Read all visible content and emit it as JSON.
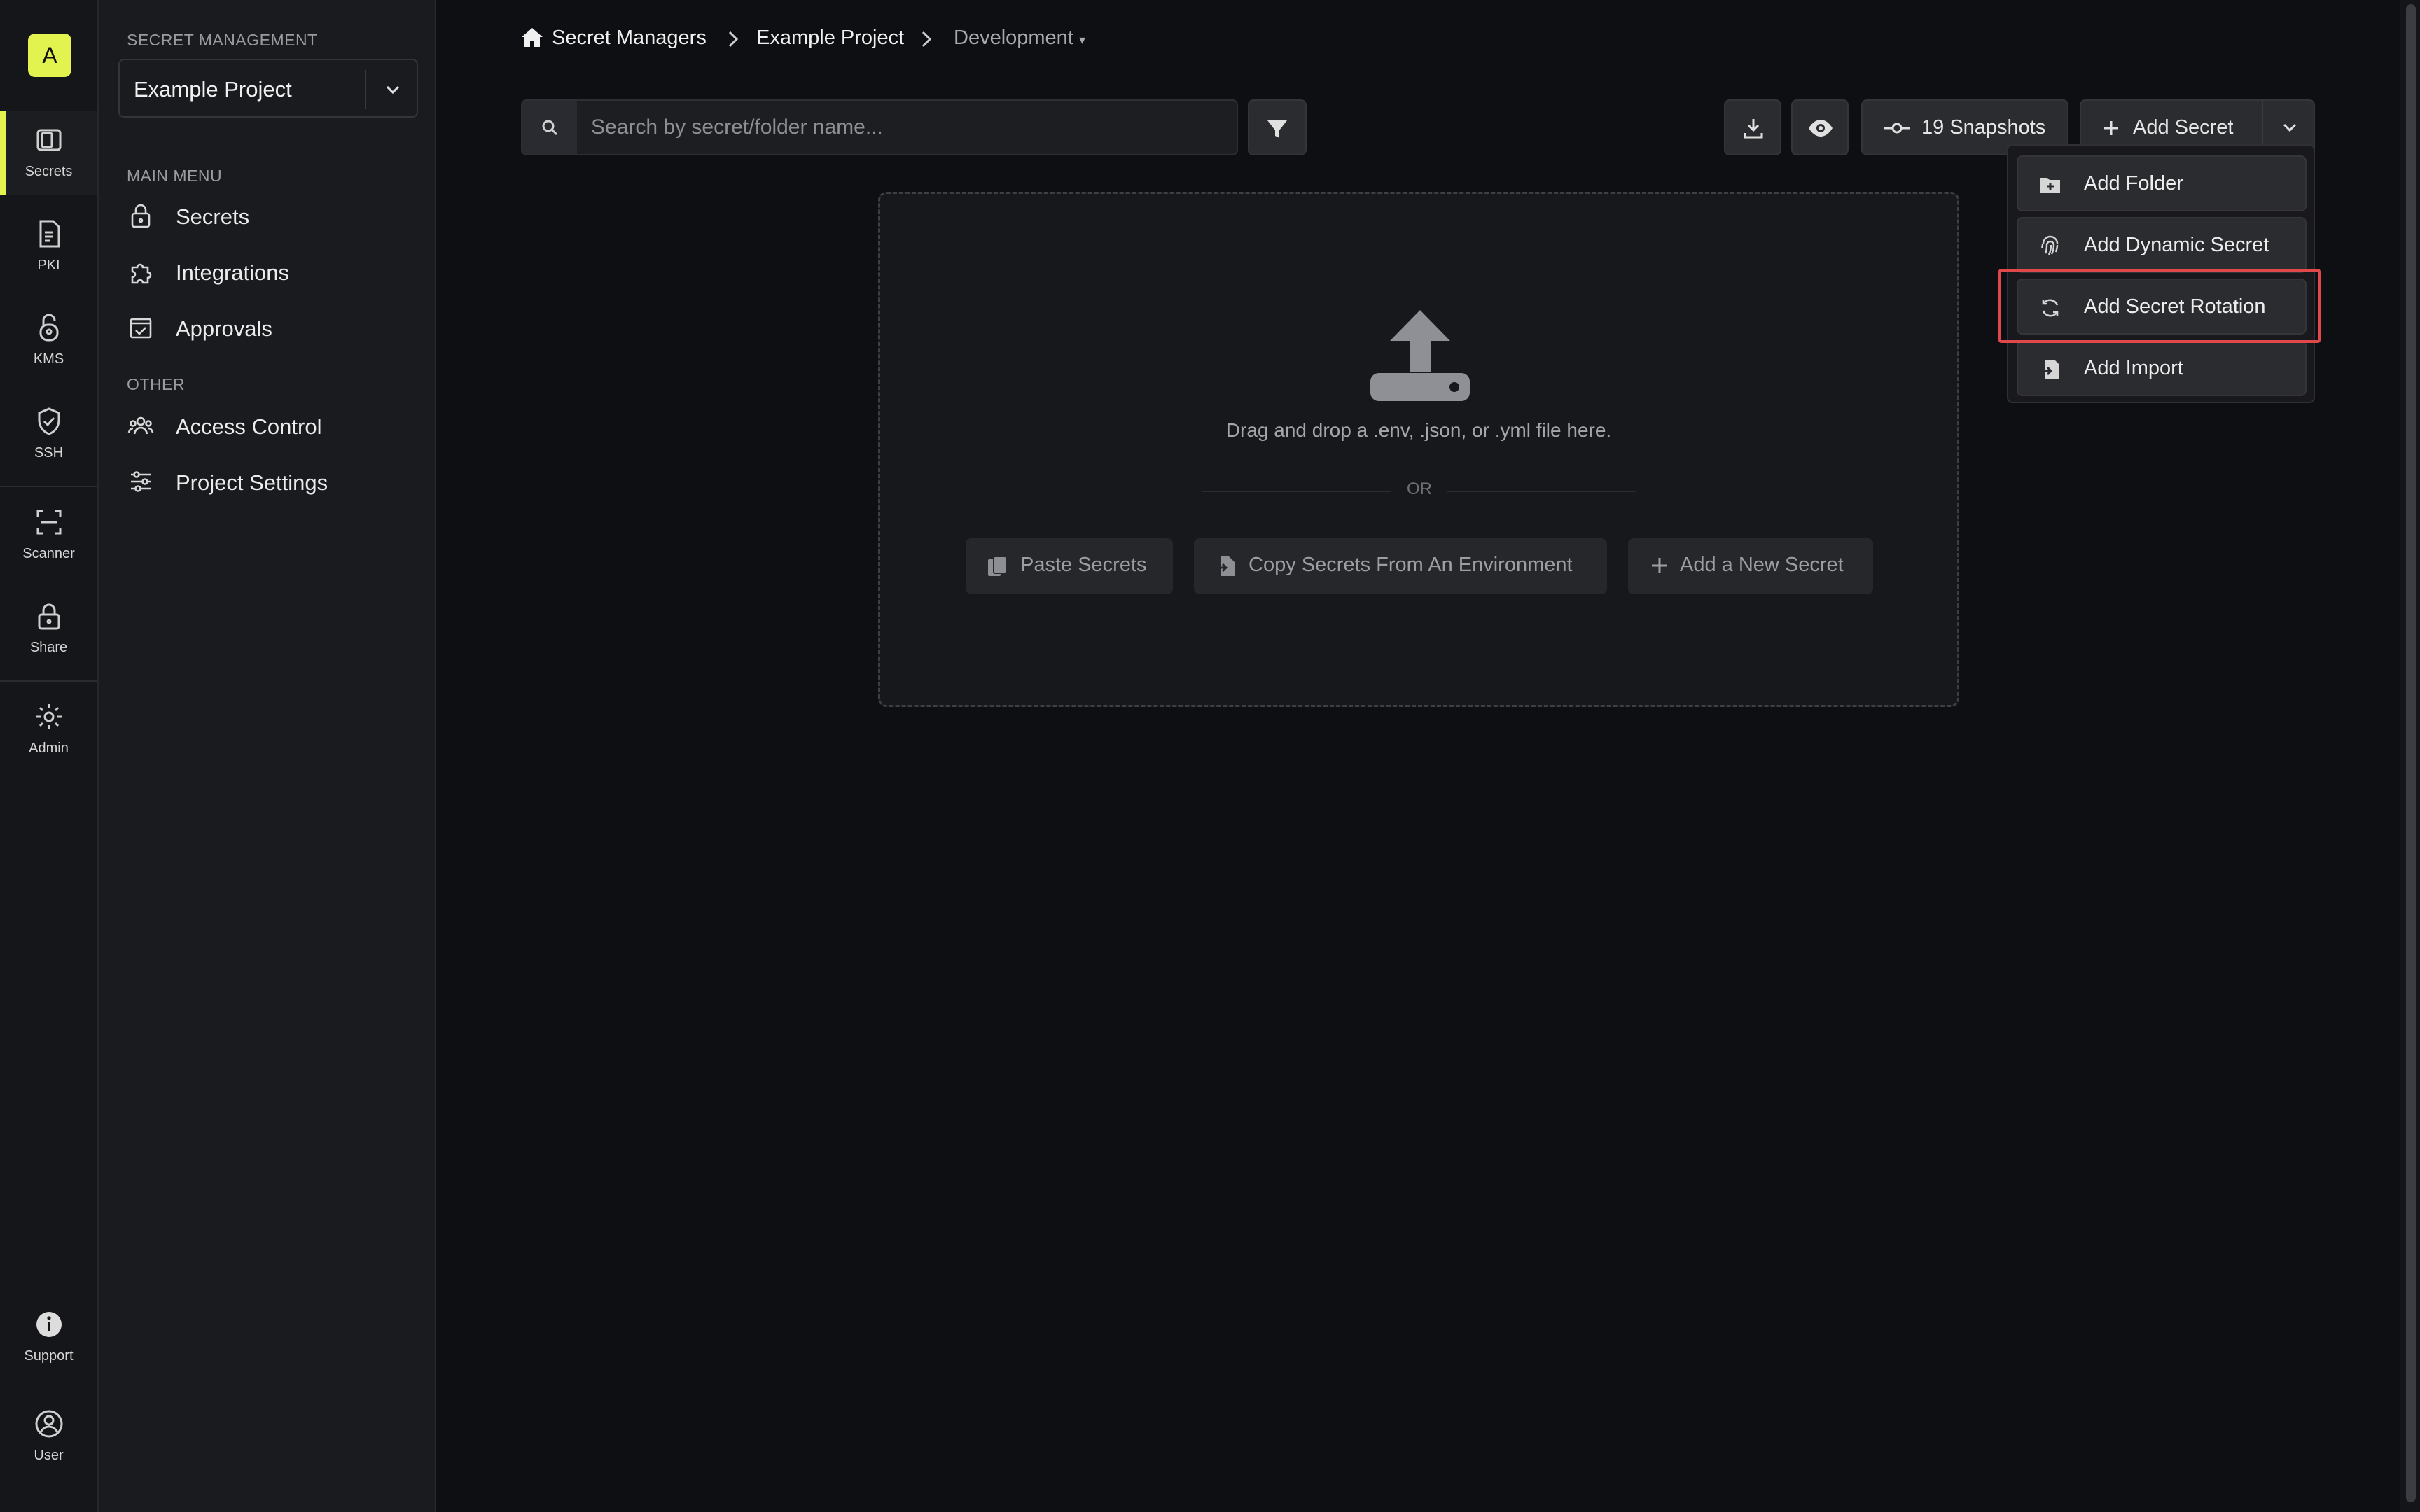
{
  "rail": {
    "org_initial": "A",
    "items": [
      {
        "label": "Secrets",
        "icon": "vault-icon"
      },
      {
        "label": "PKI",
        "icon": "certificate-icon"
      },
      {
        "label": "KMS",
        "icon": "key-lock-icon"
      },
      {
        "label": "SSH",
        "icon": "shield-check-icon"
      },
      {
        "label": "Scanner",
        "icon": "scan-icon"
      },
      {
        "label": "Share",
        "icon": "lock-icon"
      },
      {
        "label": "Admin",
        "icon": "gear-icon"
      },
      {
        "label": "Support",
        "icon": "info-icon"
      },
      {
        "label": "User",
        "icon": "user-icon"
      }
    ],
    "active": "Secrets",
    "accent": "#e2f24f"
  },
  "sidebar": {
    "section_title": "SECRET MANAGEMENT",
    "project_select": {
      "value": "Example Project"
    },
    "main_menu_title": "MAIN MENU",
    "main_menu": [
      {
        "label": "Secrets",
        "icon": "lock-icon"
      },
      {
        "label": "Integrations",
        "icon": "puzzle-icon"
      },
      {
        "label": "Approvals",
        "icon": "calendar-check-icon"
      }
    ],
    "other_title": "OTHER",
    "other_menu": [
      {
        "label": "Access Control",
        "icon": "users-icon"
      },
      {
        "label": "Project Settings",
        "icon": "sliders-icon"
      }
    ]
  },
  "breadcrumb": {
    "items": [
      "Secret Managers",
      "Example Project",
      "Development"
    ]
  },
  "toolbar": {
    "search_placeholder": "Search by secret/folder name...",
    "snapshots_label": "19 Snapshots",
    "add_secret_label": "Add Secret"
  },
  "dropzone": {
    "hint": "Drag and drop a .env, .json, or .yml file here.",
    "or": "OR",
    "buttons": [
      "Paste Secrets",
      "Copy Secrets From An Environment",
      "Add a New Secret"
    ]
  },
  "dropdown": {
    "items": [
      "Add Folder",
      "Add Dynamic Secret",
      "Add Secret Rotation",
      "Add Import"
    ],
    "highlighted": "Add Secret Rotation",
    "highlight_color": "#e0484b"
  }
}
